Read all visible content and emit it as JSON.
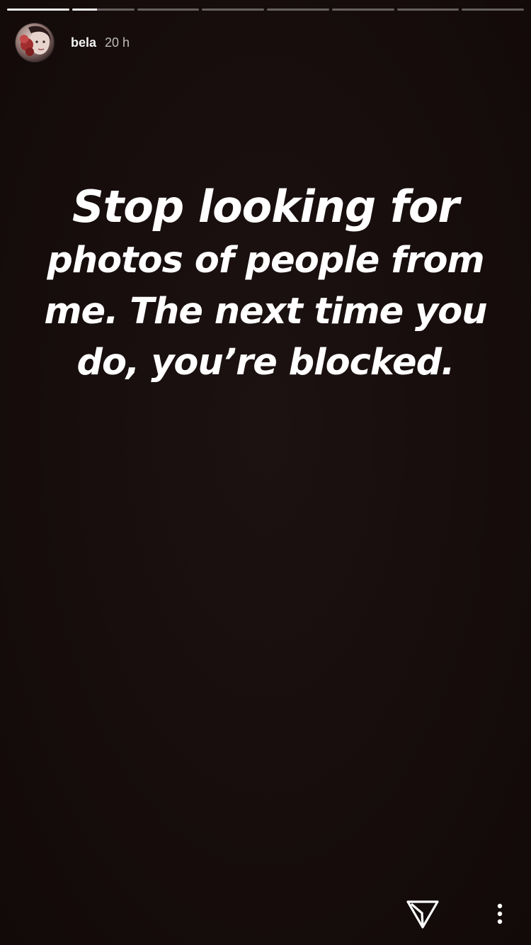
{
  "story": {
    "username": "bela",
    "timestamp": "20 h",
    "segments": [
      {
        "progress": 1.0
      },
      {
        "progress": 0.4
      },
      {
        "progress": 0.0
      },
      {
        "progress": 0.0
      },
      {
        "progress": 0.0
      },
      {
        "progress": 0.0
      },
      {
        "progress": 0.0
      },
      {
        "progress": 0.0
      }
    ],
    "text_lines": [
      "Stop looking for",
      "photos of people from",
      "me. The next time you",
      "do, you’re blocked."
    ]
  },
  "icons": {
    "send": "send-icon",
    "more": "more-vertical-icon"
  },
  "colors": {
    "background": "#170d0d",
    "text": "#ffffff"
  }
}
